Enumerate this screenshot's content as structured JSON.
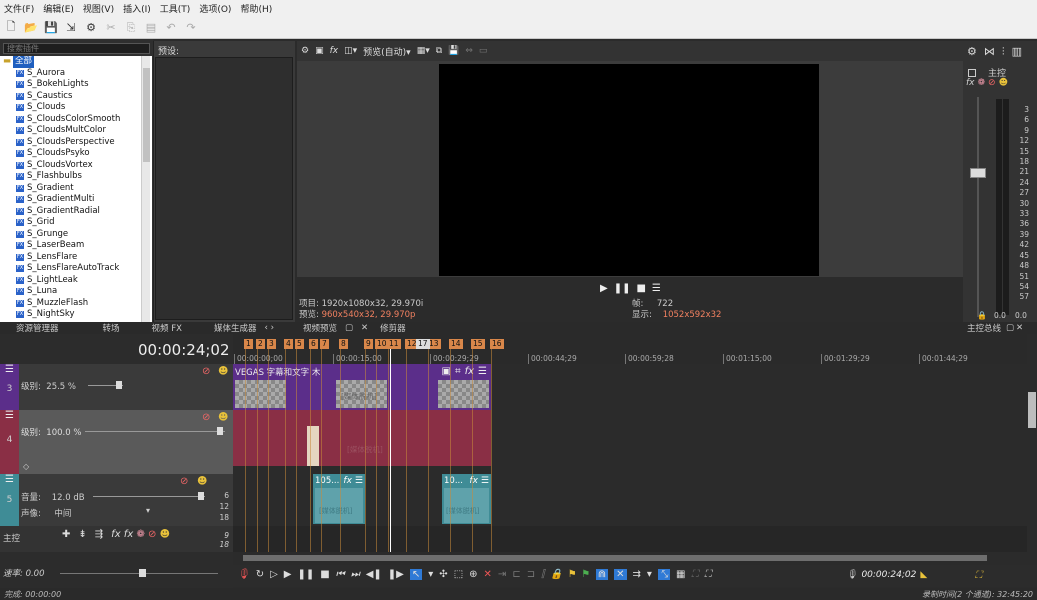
{
  "menu": [
    "文件(F)",
    "编辑(E)",
    "视图(V)",
    "插入(I)",
    "工具(T)",
    "选项(O)",
    "帮助(H)"
  ],
  "explorer": {
    "search_placeholder": "搜索插件",
    "root_label": "全部",
    "items": [
      "S_Aurora",
      "S_BokehLights",
      "S_Caustics",
      "S_Clouds",
      "S_CloudsColorSmooth",
      "S_CloudsMultColor",
      "S_CloudsPerspective",
      "S_CloudsPsyko",
      "S_CloudsVortex",
      "S_Flashbulbs",
      "S_Gradient",
      "S_GradientMulti",
      "S_GradientRadial",
      "S_Grid",
      "S_Grunge",
      "S_LaserBeam",
      "S_LensFlare",
      "S_LensFlareAutoTrack",
      "S_LightLeak",
      "S_Luna",
      "S_MuzzleFlash",
      "S_NightSky"
    ],
    "preset_label": "预设:"
  },
  "tabs": {
    "left": [
      "资源管理器",
      "转场",
      "视频 FX",
      "媒体生成器"
    ],
    "preview": "视频预览",
    "trimmer": "修剪器",
    "master": "主控总线"
  },
  "preview": {
    "mode_label": "预览(自动)",
    "project_line": "项目: 1920x1080x32, 29.970i",
    "preview_prefix": "预览: ",
    "preview_value": "960x540x32, 29.970p",
    "frame_label": "帧:",
    "frame_value": "722",
    "display_label": "显示:",
    "display_value": "1052x592x32"
  },
  "mixer": {
    "title": "主控",
    "scale": [
      "3",
      "6",
      "9",
      "12",
      "15",
      "18",
      "21",
      "24",
      "27",
      "30",
      "33",
      "36",
      "39",
      "42",
      "45",
      "48",
      "51",
      "54",
      "57"
    ],
    "left_value": "0.0",
    "right_value": "0.0"
  },
  "timeline": {
    "timecode": "00:00:24;02",
    "ruler_labels": [
      "00:00:00;00",
      "00:00:15;00",
      "00:00:29;29",
      "00:00:44;29",
      "00:00:59;28",
      "00:01:15;00",
      "00:01:29;29",
      "00:01:44;29"
    ],
    "markers": [
      "1",
      "2",
      "3",
      "4",
      "5",
      "6",
      "7",
      "8",
      "9",
      "10",
      "11",
      "12",
      "13",
      "14",
      "15",
      "16"
    ],
    "playhead_marker": "17",
    "track1": {
      "number": "3",
      "level_label": "级别:",
      "level_value": "25.5 %",
      "clip_title": "VEGAS 字幕和文字 木",
      "placeholder": "[媒体脱机]"
    },
    "track2": {
      "number": "4",
      "level_label": "级别:",
      "level_value": "100.0 %",
      "placeholder": "[媒体脱机]"
    },
    "track3": {
      "number": "5",
      "volume_label": "音量:",
      "volume_value": "12.0 dB",
      "pan_label": "声像:",
      "pan_value": "中间",
      "clip_a": "105...",
      "clip_b": "10...",
      "placeholder": "[媒体脱机]",
      "scale": [
        "6",
        "12",
        "18"
      ]
    },
    "master_label": "主控",
    "master_scale": [
      "9",
      "18"
    ],
    "rate_label": "速率: 0.00"
  },
  "bottom": {
    "timecode": "00:00:24;02"
  },
  "status": {
    "left": "完成: 00:00:00",
    "right": "录制时间(2 个通道): 32:45:20"
  },
  "colors": {
    "track_video1": "#5b2e8a",
    "track_video2": "#8a2f45",
    "track_audio": "#3f8c96",
    "accent_blue": "#2f7ad6",
    "marker_orange": "#d9874a"
  }
}
